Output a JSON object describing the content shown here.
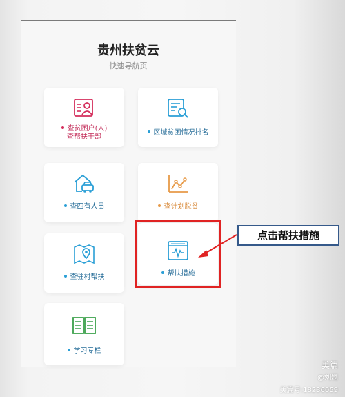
{
  "app": {
    "title": "贵州扶贫云",
    "subtitle": "快速导航页"
  },
  "menu": [
    {
      "line1": "查贫困户(人)",
      "line2": "查帮扶干部",
      "icon": "id-card-icon",
      "color": "#d42d5b"
    },
    {
      "line1": "区域贫困情况排名",
      "icon": "report-search-icon",
      "color": "#2a9fd6"
    },
    {
      "line1": "查四有人员",
      "icon": "house-car-icon",
      "color": "#2a9fd6"
    },
    {
      "line1": "查计划脱贫",
      "icon": "line-chart-icon",
      "color": "#e79a48"
    },
    {
      "line1": "查驻村帮扶",
      "icon": "map-pin-icon",
      "color": "#2a9fd6"
    },
    {
      "line1": "帮扶措施",
      "icon": "monitor-chart-icon",
      "color": "#2a9fd6"
    },
    {
      "line1": "学习专栏",
      "icon": "open-book-icon",
      "color": "#2a9fd6"
    }
  ],
  "annotation": {
    "callout_text": "点击帮扶措施",
    "highlight_color": "#e02323",
    "callout_border_color": "#35598a"
  },
  "watermark": {
    "brand": "美篇",
    "author": "@刘题",
    "id": "美篇号:18236059"
  }
}
